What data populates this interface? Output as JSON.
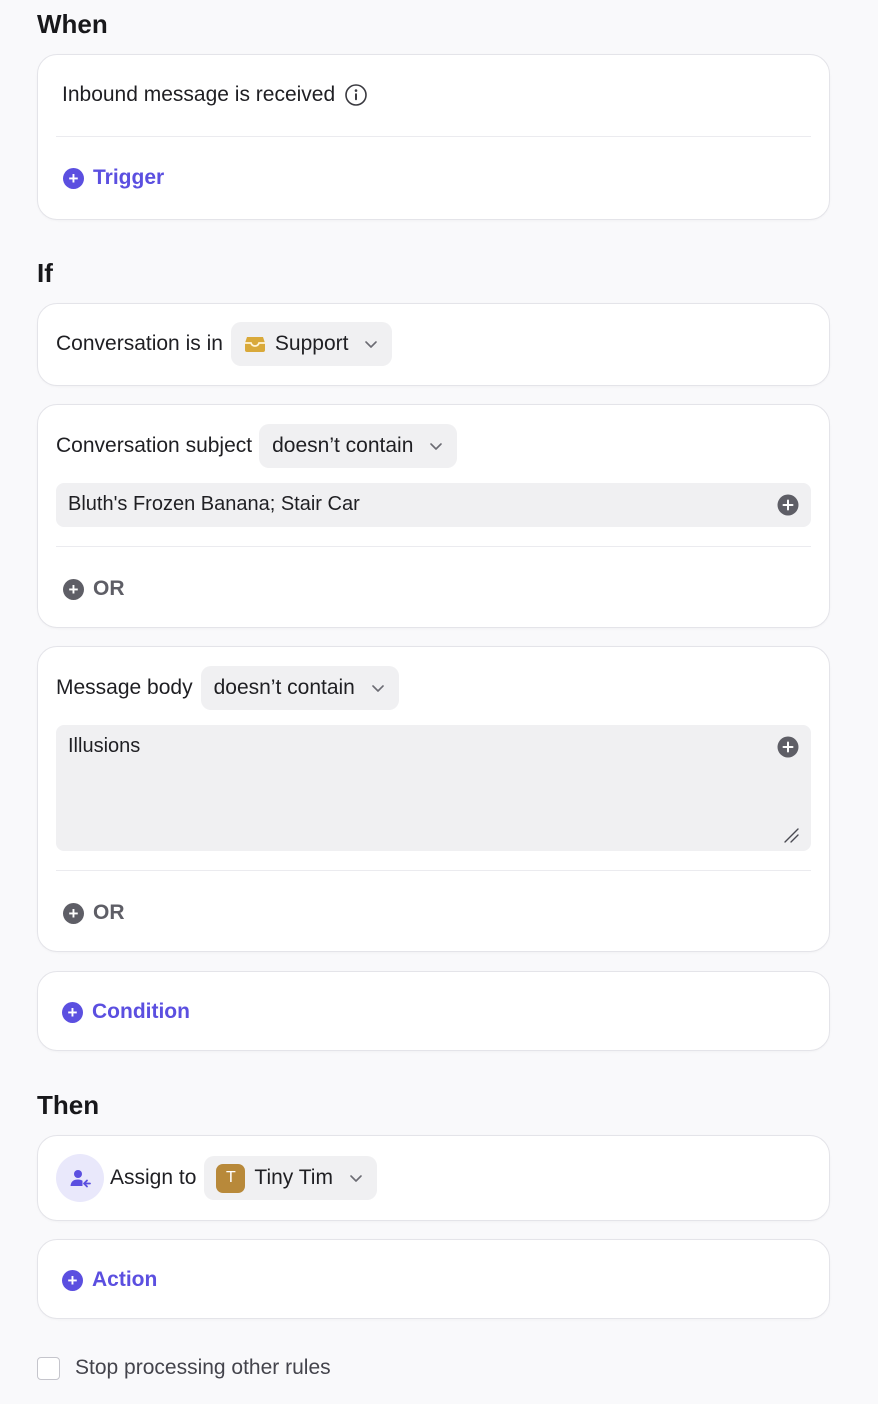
{
  "when": {
    "title": "When",
    "trigger_text": "Inbound message is received",
    "add_trigger_label": "Trigger"
  },
  "if": {
    "title": "If",
    "inbox_condition": {
      "label": "Conversation is in",
      "inbox_value": "Support"
    },
    "subject_condition": {
      "label": "Conversation subject",
      "operator": "doesn’t contain",
      "value": "Bluth's Frozen Banana; Stair Car",
      "or_label": "OR"
    },
    "body_condition": {
      "label": "Message body",
      "operator": "doesn’t contain",
      "value": "Illusions",
      "or_label": "OR"
    },
    "add_condition_label": "Condition"
  },
  "then": {
    "title": "Then",
    "assign_label": "Assign to",
    "assignee_initial": "T",
    "assignee_name": "Tiny Tim",
    "add_action_label": "Action"
  },
  "stop_processing": {
    "label": "Stop processing other rules",
    "checked": false
  },
  "colors": {
    "accent": "#5b4fe0",
    "avatar": "#b8893a",
    "inbox_icon": "#d9a93a"
  },
  "icons": [
    "info-icon",
    "plus-circle-icon",
    "inbox-icon",
    "chevron-down-icon",
    "assign-user-icon",
    "resize-handle-icon"
  ]
}
